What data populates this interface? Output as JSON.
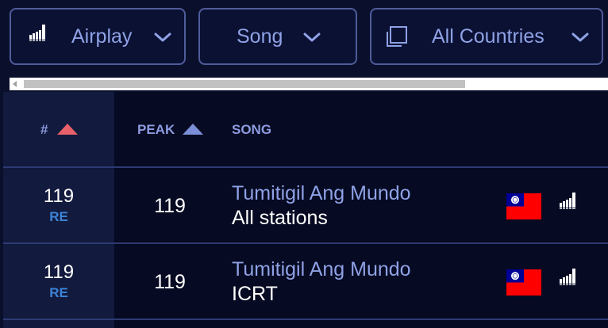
{
  "filters": {
    "chart_type": {
      "label": "Airplay",
      "icon": "airplay-bars-icon"
    },
    "entity": {
      "label": "Song"
    },
    "region": {
      "label": "All Countries",
      "icon": "stacked-squares-icon"
    }
  },
  "table": {
    "headers": {
      "rank": "#",
      "peak": "PEAK",
      "song": "SONG"
    },
    "sort_color": "#e8606a",
    "peak_sort_color": "#7b8fd8",
    "rows": [
      {
        "rank": "119",
        "status": "RE",
        "peak": "119",
        "song": "Tumitigil Ang Mundo",
        "station": "All stations",
        "flag": "taiwan-flag",
        "icon": "airplay-bars-icon"
      },
      {
        "rank": "119",
        "status": "RE",
        "peak": "119",
        "song": "Tumitigil Ang Mundo",
        "station": "ICRT",
        "flag": "taiwan-flag",
        "icon": "airplay-bars-icon"
      }
    ]
  },
  "colors": {
    "accent": "#8fa2e6",
    "status_re": "#3d84d8",
    "background": "#0a0f2b"
  }
}
